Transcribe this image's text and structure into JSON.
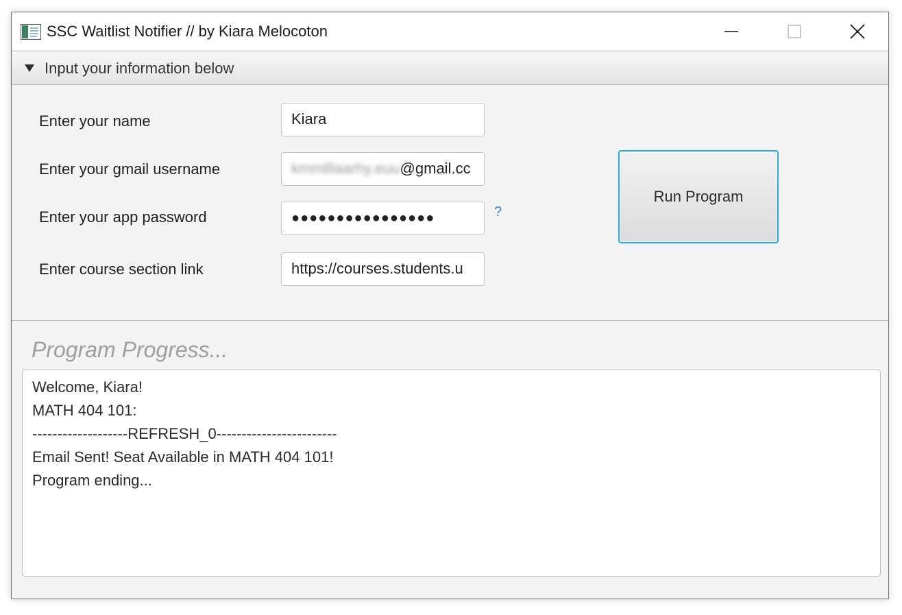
{
  "window": {
    "title": "SSC Waitlist Notifier // by Kiara Melocoton",
    "controls": {
      "minimize_icon": "minimize-icon",
      "maximize_icon": "maximize-icon",
      "close_icon": "close-icon"
    }
  },
  "input_pane": {
    "title": "Input your information below",
    "fields": [
      {
        "label": "Enter your name",
        "value": "Kiara"
      },
      {
        "label": "Enter your gmail username",
        "value_obscured": "kmmlllaarhy.euu",
        "value_visible": "@gmail.cc"
      },
      {
        "label": "Enter your app password",
        "value": "●●●●●●●●●●●●●●●●"
      },
      {
        "label": "Enter course section link",
        "value": "https://courses.students.u"
      }
    ],
    "help_mark": "?",
    "run_button_label": "Run Program"
  },
  "progress": {
    "title": "Program Progress...",
    "log_lines": [
      "Welcome, Kiara!",
      "MATH 404 101:",
      "-------------------REFRESH_0------------------------",
      "Email Sent! Seat Available in MATH 404 101!",
      "Program ending..."
    ]
  },
  "colors": {
    "accent": "#2aa8e0",
    "help": "#2a8ad6",
    "progress_title": "#9e9e9e"
  }
}
